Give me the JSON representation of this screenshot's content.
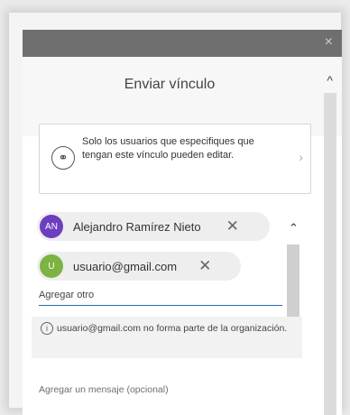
{
  "dialog": {
    "title": "Enviar vínculo",
    "close_glyph": "×",
    "scroll_up_glyph": "^"
  },
  "permission": {
    "icon": "link-edit-icon",
    "icon_glyph": "⚭",
    "text": "Solo los usuarios que especifiques que tengan este vínculo pueden editar.",
    "chevron_glyph": "›"
  },
  "recipients": [
    {
      "initials": "AN",
      "name": "Alejandro Ramírez Nieto",
      "avatar_color": "#6b3fbf",
      "remove_glyph": "✕"
    },
    {
      "initials": "U",
      "name": "usuario@gmail.com",
      "avatar_color": "#7cb342",
      "remove_glyph": "✕"
    }
  ],
  "inner_scroll": {
    "up_glyph": "⌃",
    "down_glyph": "⌄"
  },
  "add_input": {
    "placeholder": "Agregar otro"
  },
  "warning": {
    "icon": "info-icon",
    "icon_glyph": "i",
    "text": "usuario@gmail.com no forma parte de la organización."
  },
  "message": {
    "placeholder": "Agregar un mensaje (opcional)"
  }
}
